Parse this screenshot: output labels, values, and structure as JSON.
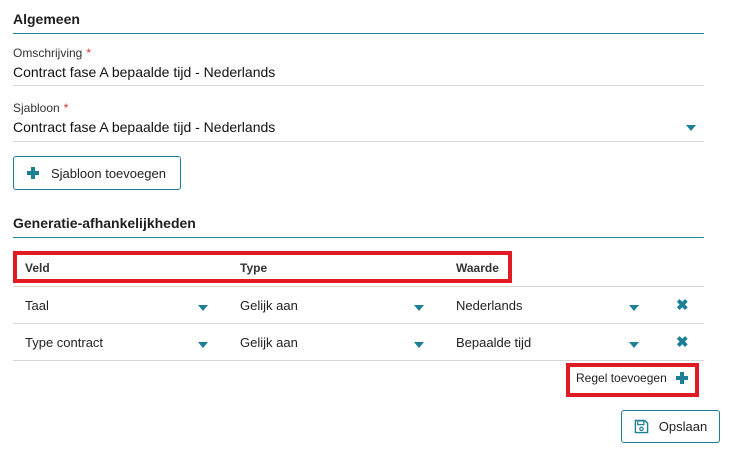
{
  "general": {
    "title": "Algemeen",
    "description_label": "Omschrijving",
    "description_value": "Contract fase A bepaalde tijd - Nederlands",
    "template_label": "Sjabloon",
    "template_value": "Contract fase A bepaalde tijd - Nederlands",
    "required_mark": "*",
    "add_template_button": "Sjabloon toevoegen"
  },
  "dependencies": {
    "title": "Generatie-afhankelijkheden",
    "columns": [
      "Veld",
      "Type",
      "Waarde"
    ],
    "rows": [
      {
        "field": "Taal",
        "type": "Gelijk aan",
        "value": "Nederlands"
      },
      {
        "field": "Type contract",
        "type": "Gelijk aan",
        "value": "Bepaalde tijd"
      }
    ],
    "add_rule_button": "Regel toevoegen"
  },
  "actions": {
    "save_button": "Opslaan"
  },
  "icons": {
    "caret": "caret-down-icon",
    "plus": "plus-icon",
    "remove": "close-icon",
    "save": "floppy-disk-icon"
  },
  "colors": {
    "accent": "#1c7f96",
    "required": "#d9342b",
    "highlight": "#e01b24"
  }
}
